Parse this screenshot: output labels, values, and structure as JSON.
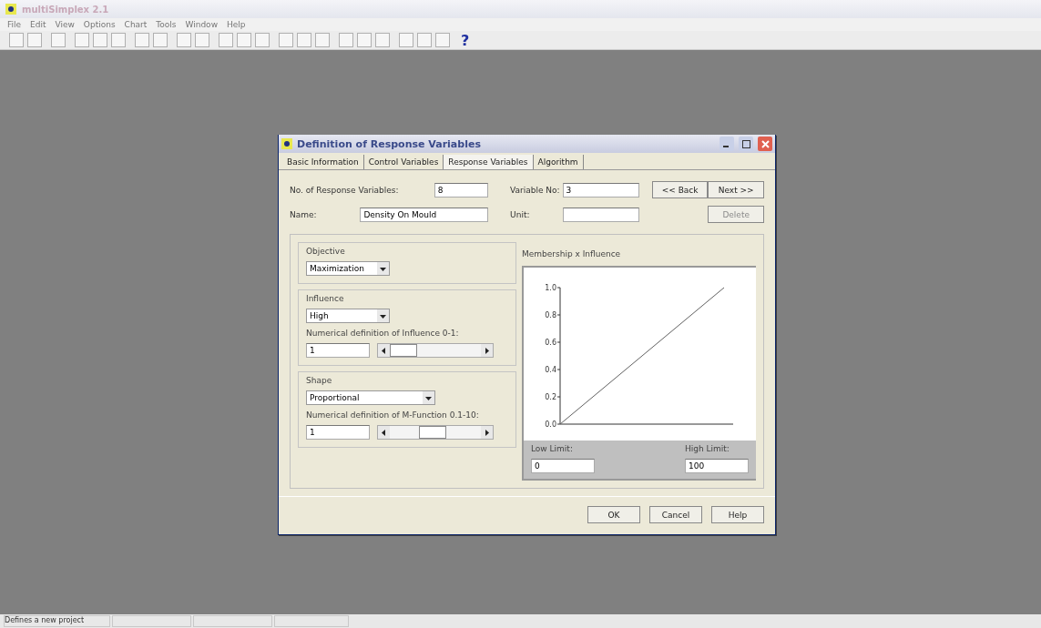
{
  "app": {
    "title": "multiSimplex 2.1",
    "menu": [
      "File",
      "Edit",
      "View",
      "Options",
      "Chart",
      "Tools",
      "Window",
      "Help"
    ],
    "help_glyph": "?"
  },
  "dialog": {
    "title": "Definition of Response Variables",
    "tabs": [
      {
        "label": "Basic Information",
        "selected": false
      },
      {
        "label": "Control Variables",
        "selected": false
      },
      {
        "label": "Response Variables",
        "selected": true
      },
      {
        "label": "Algorithm",
        "selected": false
      }
    ],
    "fields": {
      "count_label": "No. of Response Variables:",
      "count": "8",
      "varno_label": "Variable No:",
      "varno": "3",
      "name_label": "Name:",
      "name": "Density On Mould",
      "unit_label": "Unit:"
    },
    "nav_buttons": [
      {
        "label": "<< Back",
        "disabled": false
      },
      {
        "label": "Next >>",
        "disabled": false
      },
      {
        "label": "Delete",
        "disabled": true
      }
    ],
    "objective": {
      "title": "Objective",
      "value": "Maximization"
    },
    "influence": {
      "title": "Influence",
      "value": "High",
      "numeric_label": "Numerical definition of Influence 0-1:",
      "numeric": "1",
      "level": 0
    },
    "shape": {
      "title": "Shape",
      "value": "Proportional",
      "numeric_label": "Numerical definition of M-Function 0.1-10:",
      "numeric": "1",
      "level": 0.45
    },
    "chart": {
      "title": "Membership x Influence",
      "low_label": "Low Limit:",
      "low": "0",
      "high_label": "High Limit:",
      "high": "100",
      "y_tick_labels": [
        "1.0",
        "0.8",
        "0.6",
        "0.4",
        "0.2",
        "0.0"
      ]
    },
    "buttons": [
      "OK",
      "Cancel",
      "Help"
    ]
  },
  "status_bar": {
    "text": "Defines a new project"
  }
}
